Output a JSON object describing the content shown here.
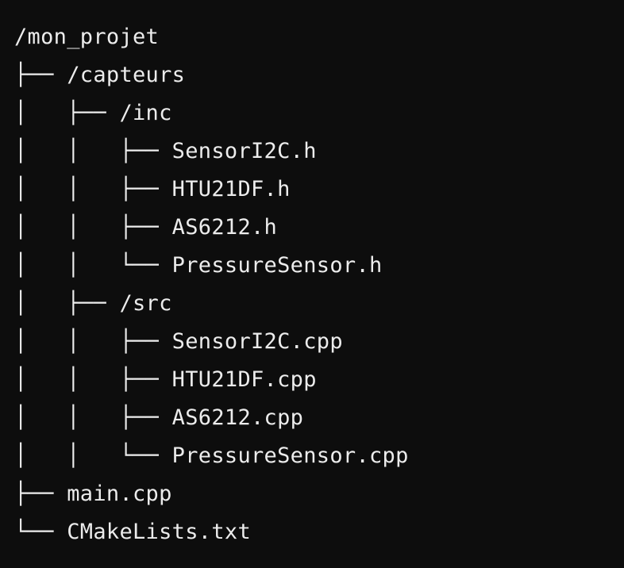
{
  "tree": {
    "lines": [
      "/mon_projet",
      "├── /capteurs",
      "│   ├── /inc",
      "│   │   ├── SensorI2C.h",
      "│   │   ├── HTU21DF.h",
      "│   │   ├── AS6212.h",
      "│   │   └── PressureSensor.h",
      "│   ├── /src",
      "│   │   ├── SensorI2C.cpp",
      "│   │   ├── HTU21DF.cpp",
      "│   │   ├── AS6212.cpp",
      "│   │   └── PressureSensor.cpp",
      "├── main.cpp",
      "└── CMakeLists.txt"
    ]
  }
}
